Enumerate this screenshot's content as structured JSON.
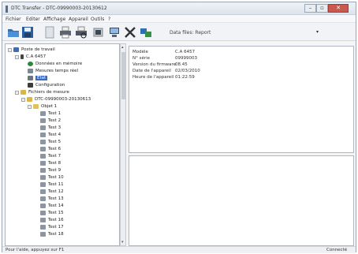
{
  "window": {
    "title": "DTC Transfer - DTC-09990003-20130612"
  },
  "menubar": {
    "items": [
      "Fichier",
      "Editer",
      "Affichage",
      "Appareil",
      "Outils",
      "?"
    ]
  },
  "toolbar": {
    "icons": [
      "open-folder-icon",
      "save-icon",
      "document-icon",
      "print-icon",
      "print-preview-icon",
      "export-icon",
      "computer-icon",
      "tools-icon",
      "network-icon"
    ],
    "dropdown_label": "Data files: Report",
    "dropdown_arrow": "▾"
  },
  "tree": {
    "root": "Poste de travail",
    "device": "C.A 6457",
    "device_children": [
      "Données en mémoire",
      "Mesures temps réel",
      "Etat",
      "Configuration"
    ],
    "measure_files": "Fichiers de mesure",
    "file": "DTC-09990003-20130613",
    "object": "Objet 1",
    "tests": [
      "Test 1",
      "Test 2",
      "Test 3",
      "Test 4",
      "Test 5",
      "Test 6",
      "Test 7",
      "Test 8",
      "Test 9",
      "Test 10",
      "Test 11",
      "Test 12",
      "Test 13",
      "Test 14",
      "Test 15",
      "Test 16",
      "Test 17",
      "Test 18"
    ]
  },
  "info_panel": {
    "rows": [
      {
        "key": "Modèle",
        "value": "C.A 6457"
      },
      {
        "key": "N° série",
        "value": "09999003"
      },
      {
        "key": "Version du firmware",
        "value": "08.45"
      },
      {
        "key": "Date de l'appareil",
        "value": "02/03/2010"
      },
      {
        "key": "Heure de l'appareil",
        "value": "01:22:59"
      }
    ]
  },
  "statusbar": {
    "left": "Pour l'aide, appuyez sur F1",
    "right": "Connecté"
  },
  "colors": {
    "selection": "#3a67c0",
    "close_button": "#c9584e"
  }
}
